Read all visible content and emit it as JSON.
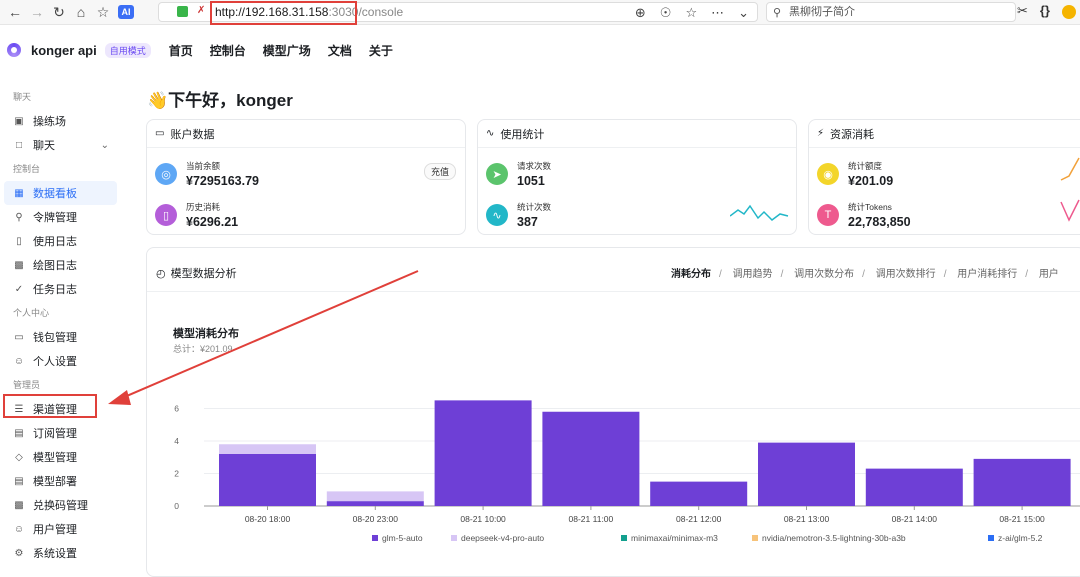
{
  "browser": {
    "url_host": "http://192.168.31.158",
    "url_port": ":3030",
    "url_path": "/console",
    "search_text": "黑柳彻子简介"
  },
  "nav": {
    "brand": "konger api",
    "mode_badge": "自用模式",
    "menu": [
      "首页",
      "控制台",
      "模型广场",
      "文档",
      "关于"
    ]
  },
  "sidebar": {
    "groups": [
      {
        "label": "聊天",
        "items": [
          {
            "label": "操练场",
            "icon": "playground-icon"
          },
          {
            "label": "聊天",
            "icon": "chat-icon"
          }
        ]
      },
      {
        "label": "控制台",
        "items": [
          {
            "label": "数据看板",
            "icon": "dashboard-icon"
          },
          {
            "label": "令牌管理",
            "icon": "key-icon"
          },
          {
            "label": "使用日志",
            "icon": "bar-icon"
          },
          {
            "label": "绘图日志",
            "icon": "image-icon"
          },
          {
            "label": "任务日志",
            "icon": "task-icon"
          }
        ]
      },
      {
        "label": "个人中心",
        "items": [
          {
            "label": "钱包管理",
            "icon": "wallet-icon"
          },
          {
            "label": "个人设置",
            "icon": "user-icon"
          }
        ]
      },
      {
        "label": "管理员",
        "items": [
          {
            "label": "渠道管理",
            "icon": "layers-icon"
          },
          {
            "label": "订阅管理",
            "icon": "calendar-icon"
          },
          {
            "label": "模型管理",
            "icon": "cube-icon"
          },
          {
            "label": "模型部署",
            "icon": "server-icon"
          },
          {
            "label": "兑换码管理",
            "icon": "gift-icon"
          },
          {
            "label": "用户管理",
            "icon": "user-icon"
          },
          {
            "label": "系统设置",
            "icon": "gear-icon"
          }
        ]
      }
    ]
  },
  "greeting": "👋下午好，konger",
  "cards": {
    "account": {
      "title": "账户数据",
      "balance_label": "当前余额",
      "balance_value": "¥7295163.79",
      "history_label": "历史消耗",
      "history_value": "¥6296.21",
      "recharge_label": "充值"
    },
    "usage": {
      "title": "使用统计",
      "requests_label": "请求次数",
      "requests_value": "1051",
      "count_label": "统计次数",
      "count_value": "387"
    },
    "resources": {
      "title": "资源消耗",
      "quota_label": "统计额度",
      "quota_value": "¥201.09",
      "tokens_label": "统计Tokens",
      "tokens_value": "22,783,850"
    }
  },
  "panel": {
    "title": "模型数据分析",
    "tabs": [
      "消耗分布",
      "调用趋势",
      "调用次数分布",
      "调用次数排行",
      "用户消耗排行",
      "用户"
    ],
    "active_tab": "消耗分布",
    "chart_title": "模型消耗分布",
    "chart_subtitle": "总计：¥201.09"
  },
  "colors": {
    "accent": "#2b6ef5",
    "series1": "#6e3fd6",
    "series2": "#d7c6f5",
    "annotation": "#e0403a"
  },
  "chart_data": {
    "type": "bar",
    "stacked": true,
    "categories": [
      "08-20 18:00",
      "08-20 23:00",
      "08-21 10:00",
      "08-21 11:00",
      "08-21 12:00",
      "08-21 13:00",
      "08-21 14:00",
      "08-21 15:00"
    ],
    "series": [
      {
        "name": "glm-5-auto",
        "color": "#6e3fd6",
        "values": [
          3.2,
          0.3,
          6.5,
          5.8,
          1.5,
          3.9,
          2.3,
          2.9
        ]
      },
      {
        "name": "deepseek-v4-pro-auto",
        "color": "#d7c6f5",
        "values": [
          0.6,
          0.6,
          0,
          0,
          0,
          0,
          0,
          0
        ]
      },
      {
        "name": "minimaxai/minimax-m3",
        "color": "#13a08e",
        "values": [
          0,
          0,
          0,
          0,
          0,
          0,
          0,
          0
        ]
      },
      {
        "name": "nvidia/nemotron-3.5-lightning-30b-a3b",
        "color": "#f7c37a",
        "values": [
          0,
          0,
          0,
          0,
          0,
          0,
          0,
          0
        ]
      },
      {
        "name": "z-ai/glm-5.2",
        "color": "#2b6ef5",
        "values": [
          0,
          0,
          0,
          0,
          0,
          0,
          0,
          0
        ]
      }
    ],
    "yticks": [
      0,
      2,
      4,
      6
    ],
    "ylim": [
      0,
      8
    ],
    "legend": "bottom"
  }
}
